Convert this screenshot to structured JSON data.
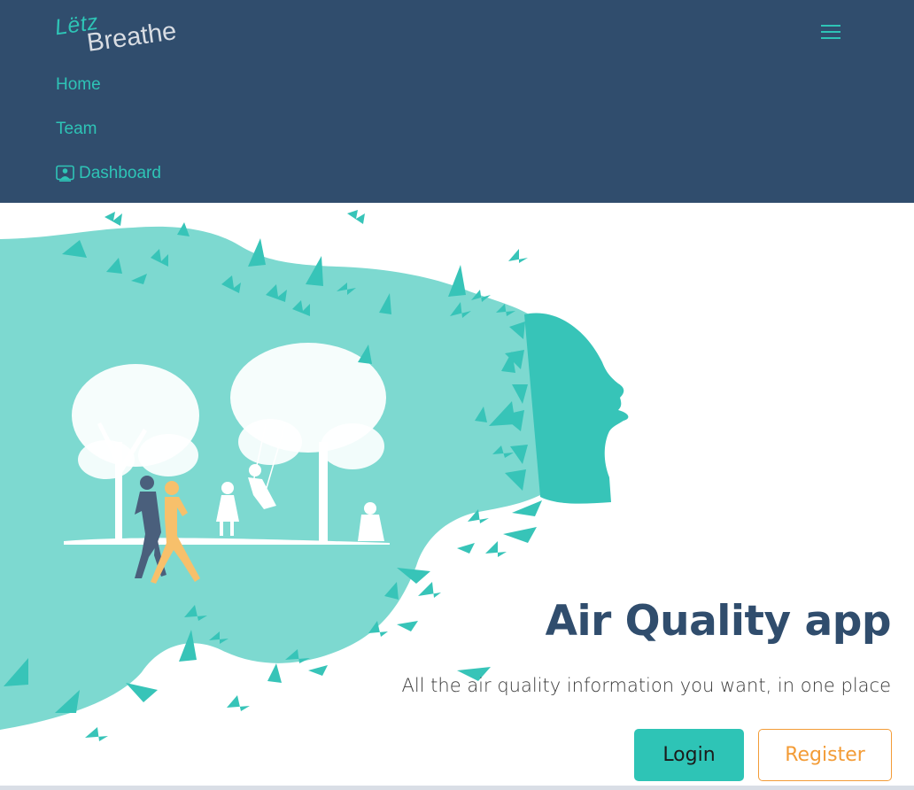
{
  "navbar": {
    "logo": {
      "part1": "Lëtz",
      "part2": "Breathe"
    },
    "menu_icon": "hamburger-menu-icon",
    "links": [
      {
        "label": "Home"
      },
      {
        "label": "Team"
      },
      {
        "label": "Dashboard",
        "icon": "user-dashboard-icon"
      }
    ]
  },
  "hero": {
    "illustration": "woman-silhouette-hair-park-with-butterflies-trees-runners",
    "title": "Air Quality app",
    "subtitle": "All the air quality information you want, in one place",
    "login_label": "Login",
    "register_label": "Register"
  },
  "colors": {
    "navbar_bg": "#304d6d",
    "accent_teal": "#2ec4b6",
    "light_teal": "#7dd9d0",
    "title_navy": "#304d6d",
    "register_orange": "#f39c37",
    "runner_yellow": "#f7c06b"
  }
}
